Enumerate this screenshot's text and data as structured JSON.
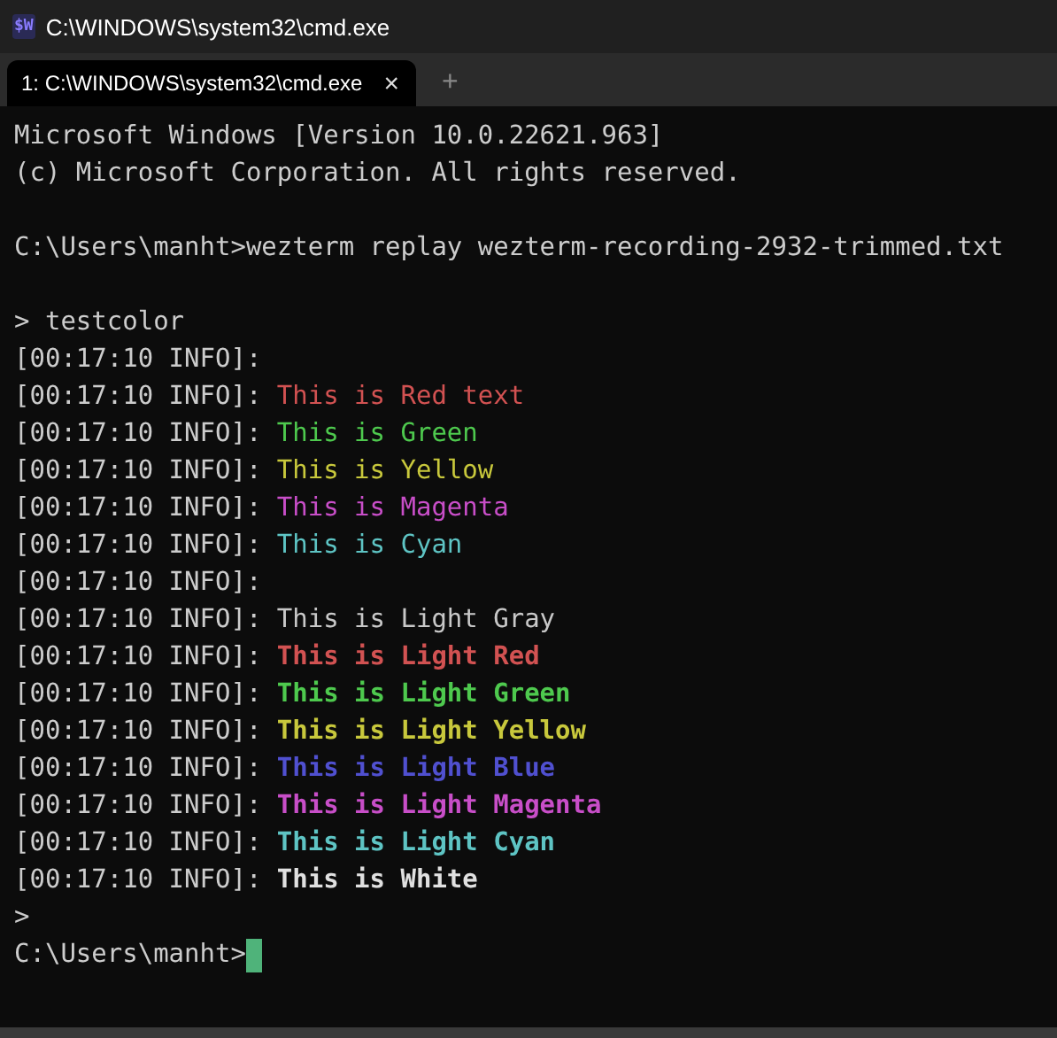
{
  "window": {
    "title": "C:\\WINDOWS\\system32\\cmd.exe",
    "app_icon": "$W"
  },
  "tabs": [
    {
      "label": "1: C:\\WINDOWS\\system32\\cmd.exe",
      "selected": true,
      "close": "×"
    }
  ],
  "new_tab": "+",
  "lines": [
    {
      "kind": "text",
      "text": "Microsoft Windows [Version 10.0.22621.963]"
    },
    {
      "kind": "text",
      "text": "(c) Microsoft Corporation. All rights reserved."
    },
    {
      "kind": "blank"
    },
    {
      "kind": "text",
      "text": "C:\\Users\\manht>wezterm replay wezterm-recording-2932-trimmed.txt"
    },
    {
      "kind": "blank"
    },
    {
      "kind": "text",
      "text": "> testcolor"
    },
    {
      "kind": "log",
      "prefix": "[00:17:10 INFO]:"
    },
    {
      "kind": "log",
      "prefix": "[00:17:10 INFO]:",
      "message": "This is Red text",
      "color": "#d25252",
      "bold": false
    },
    {
      "kind": "log",
      "prefix": "[00:17:10 INFO]:",
      "message": "This is Green",
      "color": "#4ec94e",
      "bold": false
    },
    {
      "kind": "log",
      "prefix": "[00:17:10 INFO]:",
      "message": "This is Yellow",
      "color": "#c8c83c",
      "bold": false
    },
    {
      "kind": "log",
      "prefix": "[00:17:10 INFO]:",
      "message": "This is Magenta",
      "color": "#c84ec8",
      "bold": false
    },
    {
      "kind": "log",
      "prefix": "[00:17:10 INFO]:",
      "message": "This is Cyan",
      "color": "#5ec4c4",
      "bold": false
    },
    {
      "kind": "log",
      "prefix": "[00:17:10 INFO]:"
    },
    {
      "kind": "log",
      "prefix": "[00:17:10 INFO]:",
      "message": "This is Light Gray",
      "color": "#c8c8c8",
      "bold": false
    },
    {
      "kind": "log",
      "prefix": "[00:17:10 INFO]:",
      "message": "This is Light Red",
      "color": "#d25252",
      "bold": true
    },
    {
      "kind": "log",
      "prefix": "[00:17:10 INFO]:",
      "message": "This is Light Green",
      "color": "#4ec94e",
      "bold": true
    },
    {
      "kind": "log",
      "prefix": "[00:17:10 INFO]:",
      "message": "This is Light Yellow",
      "color": "#c8c83c",
      "bold": true
    },
    {
      "kind": "log",
      "prefix": "[00:17:10 INFO]:",
      "message": "This is Light Blue",
      "color": "#5050d0",
      "bold": true
    },
    {
      "kind": "log",
      "prefix": "[00:17:10 INFO]:",
      "message": "This is Light Magenta",
      "color": "#c84ec8",
      "bold": true
    },
    {
      "kind": "log",
      "prefix": "[00:17:10 INFO]:",
      "message": "This is Light Cyan",
      "color": "#5ec4c4",
      "bold": true
    },
    {
      "kind": "log",
      "prefix": "[00:17:10 INFO]:",
      "message": "This is White",
      "color": "#e0e0e0",
      "bold": true
    },
    {
      "kind": "text",
      "text": ">"
    },
    {
      "kind": "prompt",
      "text": "C:\\Users\\manht>",
      "cursor": true
    }
  ]
}
